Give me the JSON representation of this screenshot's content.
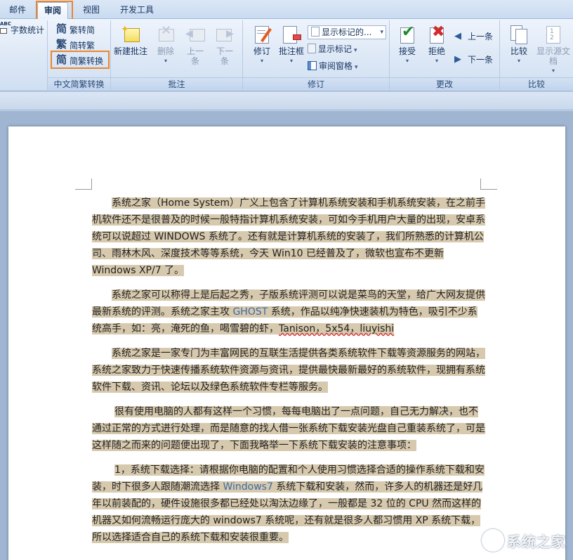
{
  "tabs": [
    {
      "label": "邮件",
      "active": false
    },
    {
      "label": "审阅",
      "active": true
    },
    {
      "label": "视图",
      "active": false
    },
    {
      "label": "开发工具",
      "active": false
    }
  ],
  "ribbon": {
    "proofing": {
      "word_count": "字数统计",
      "abc_icon_text": "ABC"
    },
    "chinese_conversion": {
      "label": "中文简繁转换",
      "to_simplified": "繁转简",
      "to_traditional": "简转繁",
      "conversion": "简繁转换"
    },
    "comments": {
      "label": "批注",
      "new_comment": "新建批注",
      "delete": "删除",
      "previous": "上一条",
      "next": "下一条"
    },
    "tracking": {
      "label": "修订",
      "track_changes": "修订",
      "balloons": "批注框",
      "display_markup": "显示标记的...",
      "show_markup": "显示标记",
      "reviewing_pane": "审阅窗格"
    },
    "changes": {
      "label": "更改",
      "accept": "接受",
      "reject": "拒绝",
      "previous": "上一条",
      "next": "下一条"
    },
    "compare": {
      "label": "比较",
      "compare": "比较",
      "show_source": "显示源文档"
    }
  },
  "document": {
    "paragraphs": [
      {
        "id": "p1",
        "text": "系统之家（Home System）广义上包含了计算机系统安装和手机系统安装，在之前手机软件还不是很普及的时候一般特指计算机系统安装，可如今手机用户大量的出现，安卓系统可以说超过 WINDOWS 系统了。还有就是计算机系统的安装了，我们所熟悉的计算机公司、雨林木风、深度技术等等系统，今天 Win10 已经普及了，微软也宣布不更新 Windows XP/7 了。"
      },
      {
        "id": "p2",
        "text_a": "系统之家可以称得上是后起之秀，子版系统评测可以说是菜鸟的天堂，给广大网友提供最新系统的评测。系统之家主攻 ",
        "link": "GHOST",
        "text_b": " 系统，作品以纯净快速装机为特色，吸引不少系统高手，如：亮，淹死的鱼，喝雪碧的虾，",
        "squiggle": "Tanison，5x54，liuyishi"
      },
      {
        "id": "p3",
        "text": "系统之家是一家专门为丰富网民的互联生活提供各类系统软件下载等资源服务的网站，系统之家致力于快速传播系统软件资源与资讯，提供最快最新最好的系统软件，现拥有系统软件下载、资讯、论坛以及绿色系统软件专栏等服务。"
      },
      {
        "id": "p4",
        "text": "很有使用电脑的人都有这样一个习惯，每每电脑出了一点问题，自己无力解决，也不通过正常的方式进行处理，而是随意的找人借一张系统下载安装光盘自己重装系统了，可是这样随之而来的问题便出现了，下面我略举一下系统下载安装的注意事项："
      },
      {
        "id": "p5",
        "text_a": "1，系统下载选择：请根据你电脑的配置和个人使用习惯选择合适的操作系统下载和安装，时下很多人跟随潮流选择 ",
        "link": "Windows7",
        "text_b": " 系统下载和安装，然而，许多人的机器还是好几年以前装配的，硬件设施很多都已经处以淘汰边缘了，一般都是 32 位的 CPU 然而这样的机器又如何流畅运行庞大的 windows7 系统呢，还有就是很多人都习惯用 XP 系统下载，所以选择适合自己的系统下载和安装很重要。"
      }
    ]
  },
  "watermark": {
    "text": "系统之家"
  },
  "colors": {
    "highlight": "#d7c9ad",
    "annotation_box": "#e8862f",
    "link_blue": "#3d6aa6"
  }
}
